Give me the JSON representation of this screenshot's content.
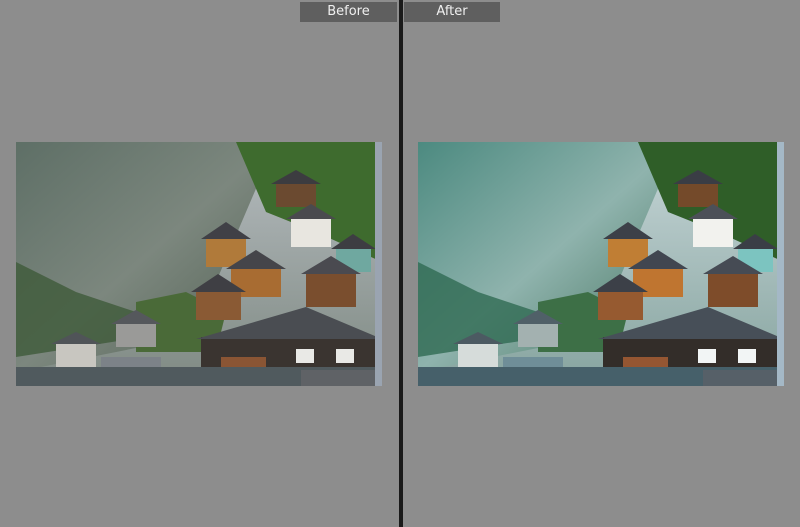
{
  "panes": {
    "before": {
      "label": "Before"
    },
    "after": {
      "label": "After"
    }
  },
  "colors": {
    "pane_bg": "#8d8d8d",
    "label_bg": "#5f5f5f",
    "divider": "#1a1a1a",
    "label_text": "#f0f0f0"
  }
}
